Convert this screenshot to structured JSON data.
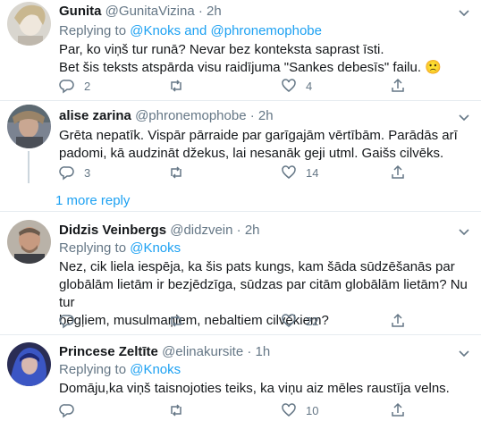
{
  "tweets": [
    {
      "name": "Gunita",
      "handle": "@GunitaVizina",
      "time": "2h",
      "replying_prefix": "Replying to ",
      "replying_to": "@Knoks and @phronemophobe",
      "body_lines": [
        "Par, ko viņš tur runā? Nevar bez konteksta saprast īsti.",
        "Bet šis teksts atspārda visu raidījuma \"Sankes debesīs\" failu. 🙁"
      ],
      "reply_count": "2",
      "retweet_count": "",
      "like_count": "4"
    },
    {
      "name": "alise zarina",
      "handle": "@phronemophobe",
      "time": "2h",
      "body_lines": [
        "Grēta nepatīk. Vispār pārraide par garīgajām vērtībām. Parādās arī",
        "padomi, kā audzināt džekus, lai nesanāk geji utml. Gaišs cilvēks."
      ],
      "reply_count": "3",
      "retweet_count": "",
      "like_count": "14"
    },
    {
      "name": "Didzis Veinbergs",
      "handle": "@didzvein",
      "time": "2h",
      "replying_prefix": "Replying to ",
      "replying_to": "@Knoks",
      "body_lines": [
        "Nez, cik liela iespēja, ka šis pats kungs, kam šāda sūdzēšanās par",
        "globālām lietām ir bezjēdzīga, sūdzas par citām globālām lietām? Nu tur",
        "bēgļiem, musulmaņiem, nebaltiem cilvēkiem?"
      ],
      "reply_count": "",
      "retweet_count": "",
      "like_count": "22"
    },
    {
      "name": "Princese Zeltīte",
      "handle": "@elinakursite",
      "time": "1h",
      "replying_prefix": "Replying to ",
      "replying_to": "@Knoks",
      "body_lines": [
        "Domāju,ka viņš taisnojoties teiks, ka viņu aiz mēles raustīja velns."
      ],
      "reply_count": "",
      "retweet_count": "",
      "like_count": "10"
    }
  ],
  "more_reply": "1 more reply",
  "separator": "·",
  "colors": {
    "accent": "#1da1f2",
    "muted": "#657786",
    "text": "#14171a",
    "border": "#e6ecf0"
  }
}
